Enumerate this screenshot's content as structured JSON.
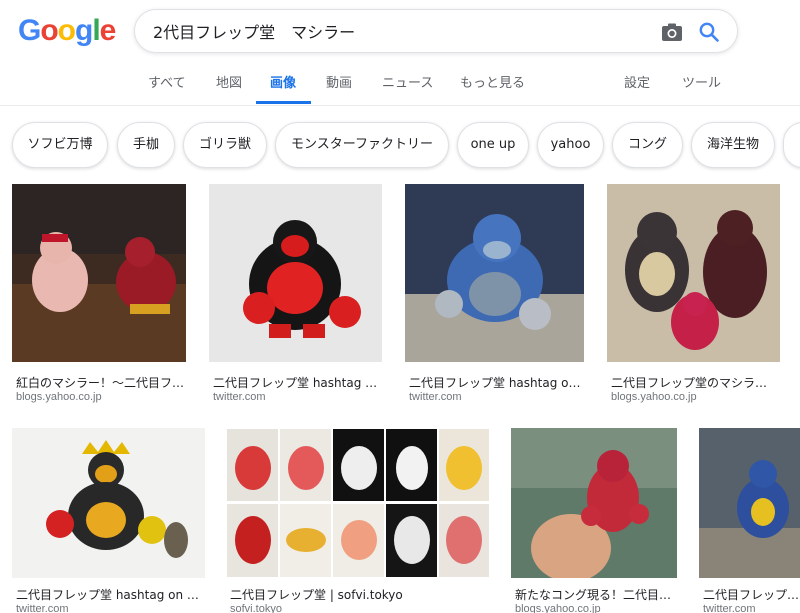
{
  "logo": {
    "letters": [
      "G",
      "o",
      "o",
      "g",
      "l",
      "e"
    ],
    "colors": [
      "#4285f4",
      "#ea4335",
      "#fbbc05",
      "#4285f4",
      "#34a853",
      "#ea4335"
    ]
  },
  "search": {
    "query": "2代目フレップ堂　マシラー"
  },
  "tabs": {
    "all": "すべて",
    "maps": "地図",
    "images": "画像",
    "videos": "動画",
    "news": "ニュース",
    "more": "もっと見る",
    "settings": "設定",
    "tools": "ツール"
  },
  "chips": [
    "ソフビ万博",
    "手枷",
    "ゴリラ獣",
    "モンスターファクトリー",
    "one up",
    "yahoo",
    "コング",
    "海洋生物"
  ],
  "results": [
    {
      "caption": "紅白のマシラー！〜二代目フ…",
      "source": "blogs.yahoo.co.jp"
    },
    {
      "caption": "二代目フレップ堂 hashtag o…",
      "source": "twitter.com"
    },
    {
      "caption": "二代目フレップ堂 hashtag on …",
      "source": "twitter.com"
    },
    {
      "caption": "二代目フレップ堂のマシラー…",
      "source": "blogs.yahoo.co.jp"
    },
    {
      "caption": "二代目フレップ堂 hashtag on T…",
      "source": "twitter.com"
    },
    {
      "caption": "二代目フレップ堂 | sofvi.tokyo",
      "source": "sofvi.tokyo"
    },
    {
      "caption": "新たなコング現る！二代目フ…",
      "source": "blogs.yahoo.co.jp"
    },
    {
      "caption": "二代目フレップ…",
      "source": "twitter.com"
    }
  ],
  "colors": {
    "accent": "#1a73e8",
    "muted": "#5f6368",
    "source": "#70757a"
  }
}
